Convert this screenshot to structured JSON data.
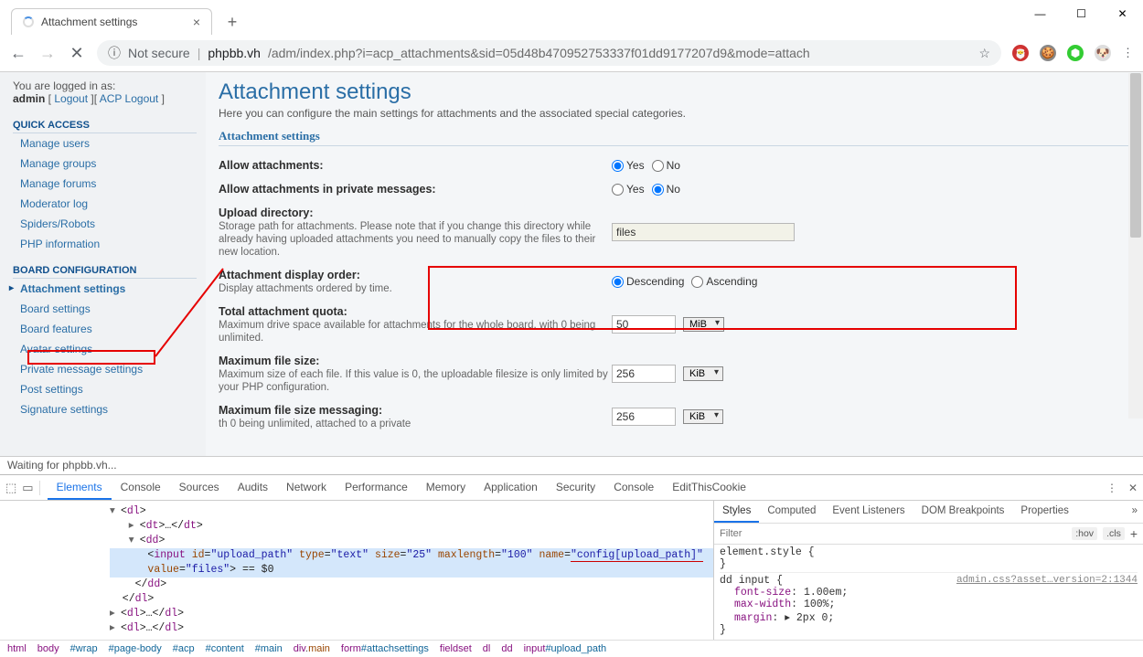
{
  "window": {
    "tab_title": "Attachment settings"
  },
  "url": {
    "scheme_label": "Not secure",
    "host": "phpbb.vh",
    "path": "/adm/index.php?i=acp_attachments&sid=05d48b470952753337f01dd9177207d9&mode=attach"
  },
  "status_bar": "Waiting for phpbb.vh...",
  "sidebar": {
    "login_prefix": "You are logged in as:",
    "username": "admin",
    "logout": "Logout",
    "acp_logout": "ACP Logout",
    "sections": [
      {
        "heading": "QUICK ACCESS",
        "items": [
          "Manage users",
          "Manage groups",
          "Manage forums",
          "Moderator log",
          "Spiders/Robots",
          "PHP information"
        ]
      },
      {
        "heading": "BOARD CONFIGURATION",
        "items": [
          "Attachment settings",
          "Board settings",
          "Board features",
          "Avatar settings",
          "Private message settings",
          "Post settings",
          "Signature settings"
        ],
        "current": "Attachment settings"
      }
    ]
  },
  "page": {
    "title": "Attachment settings",
    "desc": "Here you can configure the main settings for attachments and the associated special categories.",
    "legend": "Attachment settings",
    "rows": {
      "allow": {
        "label": "Allow attachments:",
        "yes": "Yes",
        "no": "No",
        "value": "Yes"
      },
      "allow_pm": {
        "label": "Allow attachments in private messages:",
        "yes": "Yes",
        "no": "No",
        "value": "No"
      },
      "upload_dir": {
        "label": "Upload directory:",
        "desc": "Storage path for attachments. Please note that if you change this directory while already having uploaded attachments you need to manually copy the files to their new location.",
        "value": "files"
      },
      "display_order": {
        "label": "Attachment display order:",
        "desc": "Display attachments ordered by time.",
        "opt1": "Descending",
        "opt2": "Ascending",
        "value": "Descending"
      },
      "quota": {
        "label": "Total attachment quota:",
        "desc": "Maximum drive space available for attachments for the whole board, with 0 being unlimited.",
        "value": "50",
        "unit": "MiB"
      },
      "max_filesize": {
        "label": "Maximum file size:",
        "desc": "Maximum size of each file. If this value is 0, the uploadable filesize is only limited by your PHP configuration.",
        "value": "256",
        "unit": "KiB"
      },
      "max_filesize_pm": {
        "label": "Maximum file size messaging:",
        "desc_partial": "th 0 being unlimited, attached to a private",
        "value": "256",
        "unit": "KiB"
      }
    }
  },
  "devtools": {
    "tabs": [
      "Elements",
      "Console",
      "Sources",
      "Audits",
      "Network",
      "Performance",
      "Memory",
      "Application",
      "Security",
      "Console",
      "EditThisCookie"
    ],
    "active_tab": "Elements",
    "styles_tabs": [
      "Styles",
      "Computed",
      "Event Listeners",
      "DOM Breakpoints",
      "Properties"
    ],
    "active_styles_tab": "Styles",
    "filter_placeholder": "Filter",
    "hov": ":hov",
    "cls": ".cls",
    "element_style": "element.style {",
    "rule_selector": "dd input {",
    "rule_file": "admin.css?asset…version=2:1344",
    "props": [
      {
        "n": "font-size",
        "v": "1.00em"
      },
      {
        "n": "max-width",
        "v": "100%"
      },
      {
        "n": "margin",
        "v": "▸ 2px 0"
      }
    ],
    "selected_input": {
      "id": "upload_path",
      "type": "text",
      "size": "25",
      "maxlength": "100",
      "name": "config[upload_path]",
      "value": "files"
    },
    "crumbs": [
      "html",
      "body",
      "#wrap",
      "#page-body",
      "#acp",
      "#content",
      "#main",
      "div.main",
      "form#attachsettings",
      "fieldset",
      "dl",
      "dd",
      "input#upload_path"
    ]
  }
}
